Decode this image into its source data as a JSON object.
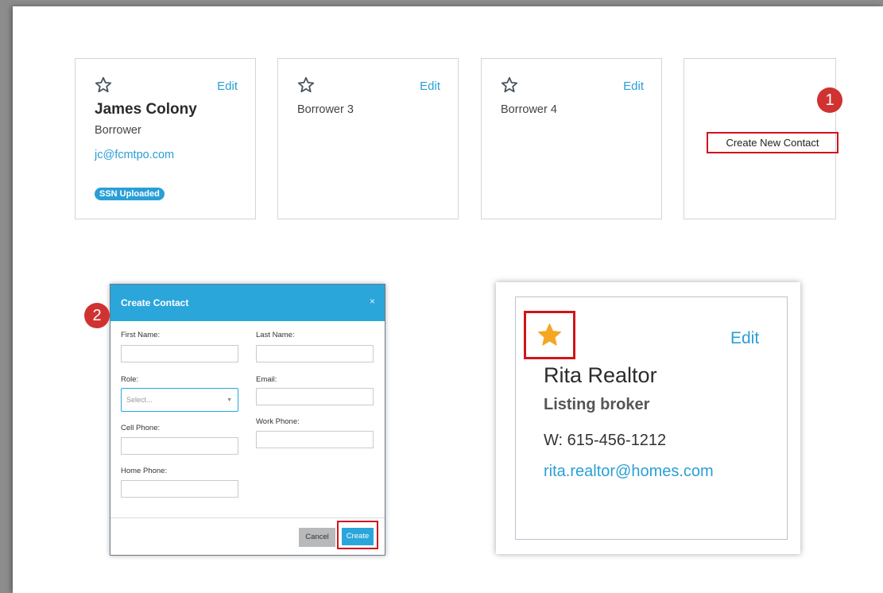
{
  "contacts": [
    {
      "name": "James Colony",
      "role": "Borrower",
      "email": "jc@fcmtpo.com",
      "badge": "SSN Uploaded",
      "edit": "Edit"
    },
    {
      "name": "Borrower 3",
      "edit": "Edit"
    },
    {
      "name": "Borrower 4",
      "edit": "Edit"
    }
  ],
  "create_new_contact_label": "Create New Contact",
  "steps": [
    "1",
    "2"
  ],
  "dialog": {
    "title": "Create Contact",
    "close": "×",
    "first_name_label": "First Name:",
    "last_name_label": "Last Name:",
    "role_label": "Role:",
    "role_placeholder": "Select...",
    "email_label": "Email:",
    "work_phone_label": "Work Phone:",
    "cell_phone_label": "Cell Phone:",
    "home_phone_label": "Home Phone:",
    "cancel_label": "Cancel",
    "create_label": "Create"
  },
  "favorite_card": {
    "name": "Rita Realtor",
    "role": "Listing broker",
    "phone": "W: 615-456-1212",
    "email": "rita.realtor@homes.com",
    "edit": "Edit"
  },
  "colors": {
    "accent": "#2a9fd6",
    "dialog_header": "#2ba6db",
    "highlight_box": "#d2141b",
    "step_marker": "#d03232",
    "favorite_star": "#f5a623"
  },
  "icons": {
    "empty_star": "star-outline-icon",
    "filled_star": "star-filled-icon",
    "close": "close-icon",
    "dropdown": "chevron-down-icon"
  }
}
